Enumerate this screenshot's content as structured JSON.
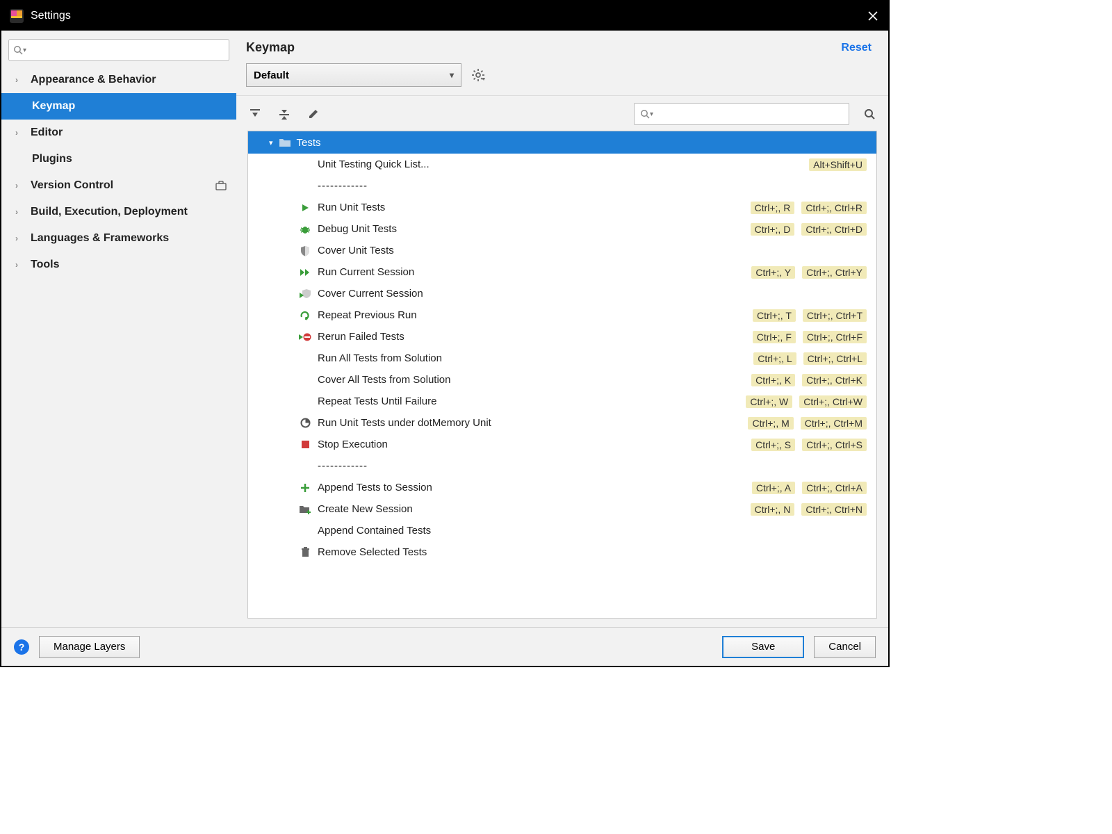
{
  "window": {
    "title": "Settings"
  },
  "sidebar": {
    "items": [
      {
        "label": "Appearance & Behavior",
        "expandable": true
      },
      {
        "label": "Keymap",
        "expandable": false,
        "selected": true
      },
      {
        "label": "Editor",
        "expandable": true
      },
      {
        "label": "Plugins",
        "expandable": false
      },
      {
        "label": "Version Control",
        "expandable": true,
        "badge": true
      },
      {
        "label": "Build, Execution, Deployment",
        "expandable": true
      },
      {
        "label": "Languages & Frameworks",
        "expandable": true
      },
      {
        "label": "Tools",
        "expandable": true
      }
    ]
  },
  "main": {
    "title": "Keymap",
    "reset": "Reset",
    "scheme_selected": "Default",
    "group_label": "Tests"
  },
  "actions": [
    {
      "type": "item",
      "label": "Unit Testing Quick List...",
      "icon": "",
      "shortcuts": [
        "Alt+Shift+U"
      ]
    },
    {
      "type": "separator"
    },
    {
      "type": "item",
      "label": "Run Unit Tests",
      "icon": "play-green",
      "shortcuts": [
        "Ctrl+;, R",
        "Ctrl+;, Ctrl+R"
      ]
    },
    {
      "type": "item",
      "label": "Debug Unit Tests",
      "icon": "bug-green",
      "shortcuts": [
        "Ctrl+;, D",
        "Ctrl+;, Ctrl+D"
      ]
    },
    {
      "type": "item",
      "label": "Cover Unit Tests",
      "icon": "shield",
      "shortcuts": []
    },
    {
      "type": "item",
      "label": "Run Current Session",
      "icon": "play-double",
      "shortcuts": [
        "Ctrl+;, Y",
        "Ctrl+;, Ctrl+Y"
      ]
    },
    {
      "type": "item",
      "label": "Cover Current Session",
      "icon": "shield-play",
      "shortcuts": []
    },
    {
      "type": "item",
      "label": "Repeat Previous Run",
      "icon": "redo-green",
      "shortcuts": [
        "Ctrl+;, T",
        "Ctrl+;, Ctrl+T"
      ]
    },
    {
      "type": "item",
      "label": "Rerun Failed Tests",
      "icon": "rerun-red",
      "shortcuts": [
        "Ctrl+;, F",
        "Ctrl+;, Ctrl+F"
      ]
    },
    {
      "type": "item",
      "label": "Run All Tests from Solution",
      "icon": "",
      "shortcuts": [
        "Ctrl+;, L",
        "Ctrl+;, Ctrl+L"
      ]
    },
    {
      "type": "item",
      "label": "Cover All Tests from Solution",
      "icon": "",
      "shortcuts": [
        "Ctrl+;, K",
        "Ctrl+;, Ctrl+K"
      ]
    },
    {
      "type": "item",
      "label": "Repeat Tests Until Failure",
      "icon": "",
      "shortcuts": [
        "Ctrl+;, W",
        "Ctrl+;, Ctrl+W"
      ]
    },
    {
      "type": "item",
      "label": "Run Unit Tests under dotMemory Unit",
      "icon": "pie",
      "shortcuts": [
        "Ctrl+;, M",
        "Ctrl+;, Ctrl+M"
      ]
    },
    {
      "type": "item",
      "label": "Stop Execution",
      "icon": "stop-red",
      "shortcuts": [
        "Ctrl+;, S",
        "Ctrl+;, Ctrl+S"
      ]
    },
    {
      "type": "separator"
    },
    {
      "type": "item",
      "label": "Append Tests to Session",
      "icon": "plus-green",
      "shortcuts": [
        "Ctrl+;, A",
        "Ctrl+;, Ctrl+A"
      ]
    },
    {
      "type": "item",
      "label": "Create New Session",
      "icon": "folder-plus",
      "shortcuts": [
        "Ctrl+;, N",
        "Ctrl+;, Ctrl+N"
      ]
    },
    {
      "type": "item",
      "label": "Append Contained Tests",
      "icon": "",
      "shortcuts": []
    },
    {
      "type": "item",
      "label": "Remove Selected Tests",
      "icon": "trash",
      "shortcuts": []
    }
  ],
  "footer": {
    "manage_layers": "Manage Layers",
    "save": "Save",
    "cancel": "Cancel"
  }
}
